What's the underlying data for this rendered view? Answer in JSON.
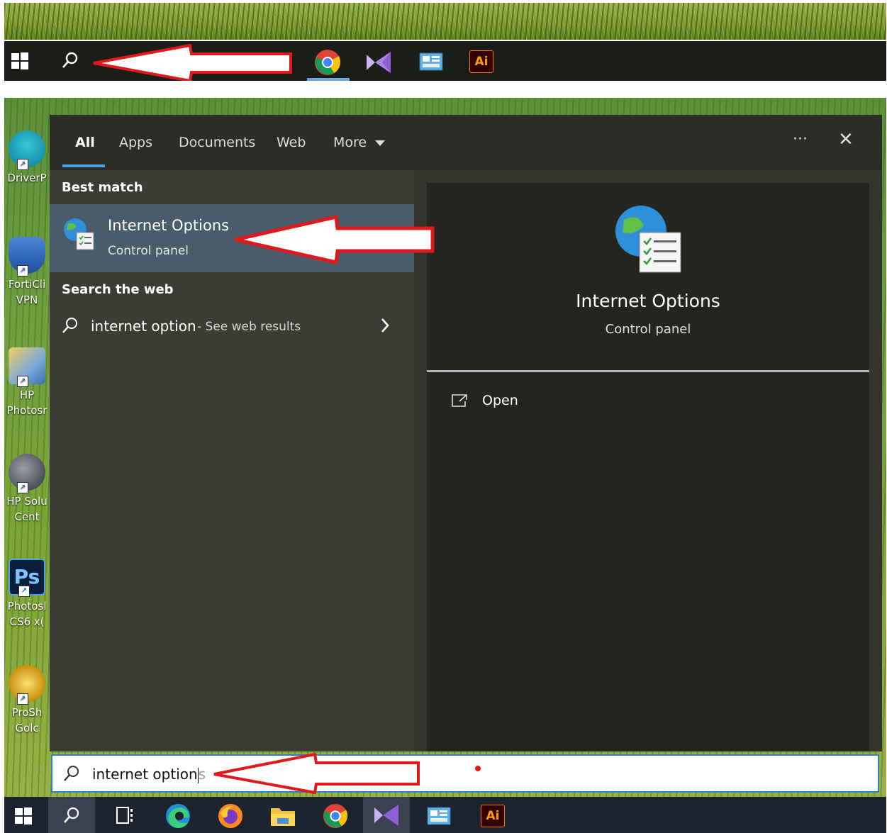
{
  "colors": {
    "accent": "#4aa3e8",
    "annotation_arrow": "#e0191c",
    "selected_row": "#4a5c6a"
  },
  "top_taskbar": {
    "icons": [
      "windows-start-icon",
      "search-icon",
      "chrome-icon",
      "visual-studio-icon",
      "control-panel-icon",
      "illustrator-icon"
    ],
    "illustrator_text": "Ai"
  },
  "desktop": {
    "icons": [
      {
        "name": "DriverP"
      },
      {
        "name": "FortiCli\nVPN"
      },
      {
        "name": "HP\nPhotosr"
      },
      {
        "name": "HP Solu\nCent"
      },
      {
        "name": "Photosl\nCS6 x("
      },
      {
        "name": "ProSh\nGolc"
      }
    ]
  },
  "search_panel": {
    "tabs": {
      "all": "All",
      "apps": "Apps",
      "documents": "Documents",
      "web": "Web",
      "more": "More"
    },
    "more_options_label": "···",
    "close_label": "✕",
    "best_match": {
      "heading": "Best match",
      "title": "Internet Options",
      "subtitle": "Control panel"
    },
    "search_web": {
      "heading": "Search the web",
      "query": "internet option",
      "suffix": " - See web results"
    },
    "preview": {
      "title": "Internet Options",
      "subtitle": "Control panel",
      "action_open": "Open"
    }
  },
  "search_box": {
    "typed": "internet option",
    "suggestion": "s"
  },
  "bottom_taskbar": {
    "icons": [
      "windows-start-icon",
      "search-icon",
      "task-view-icon",
      "edge-icon",
      "firefox-icon",
      "file-explorer-icon",
      "chrome-icon",
      "visual-studio-icon",
      "control-panel-icon",
      "illustrator-icon"
    ],
    "illustrator_text": "Ai"
  }
}
